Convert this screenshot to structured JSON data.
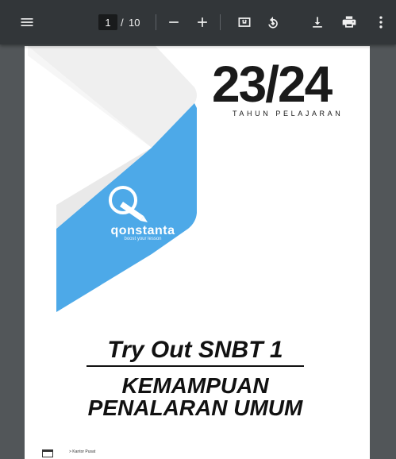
{
  "toolbar": {
    "menu_icon": "menu-icon",
    "current_page": "1",
    "page_separator": "/",
    "total_pages": "10",
    "zoom_out_icon": "minus-icon",
    "zoom_in_icon": "plus-icon",
    "fit_icon": "fit-page-icon",
    "rotate_icon": "rotate-icon",
    "download_icon": "download-icon",
    "print_icon": "print-icon",
    "more_icon": "more-vert-icon"
  },
  "document": {
    "year": "23/24",
    "year_caption": "TAHUN PELAJARAN",
    "brand_name": "qonstanta",
    "brand_tagline": "boost your lesson",
    "title": "Try Out SNBT 1",
    "subject_line1": "KEMAMPUAN",
    "subject_line2": "PENALARAN UMUM",
    "footer_text": "> Kantor Pusat"
  },
  "colors": {
    "toolbar_bg": "#323639",
    "viewer_bg": "#525659",
    "brand_blue": "#4da9e8",
    "ribbon_grey": "#f0f0f0"
  }
}
